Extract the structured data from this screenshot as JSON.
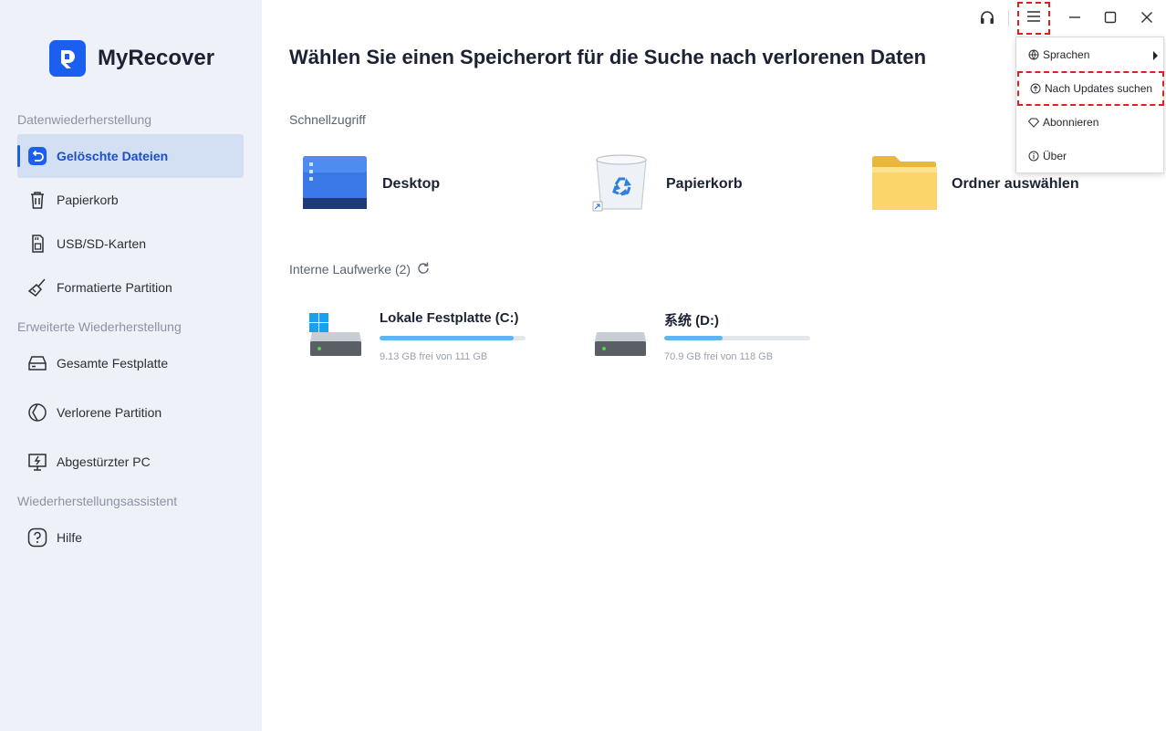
{
  "app": {
    "name": "MyRecover"
  },
  "sidebar": {
    "sections": [
      {
        "title": "Datenwiederherstellung"
      },
      {
        "title": "Erweiterte Wiederherstellung"
      },
      {
        "title": "Wiederherstellungsassistent"
      }
    ],
    "items": [
      {
        "label": "Gelöschte Dateien",
        "icon": "restore-icon",
        "active": true
      },
      {
        "label": "Papierkorb",
        "icon": "trash-icon"
      },
      {
        "label": "USB/SD-Karten",
        "icon": "sd-card-icon"
      },
      {
        "label": "Formatierte Partition",
        "icon": "broom-icon"
      },
      {
        "label": "Gesamte Festplatte",
        "icon": "hard-drive-icon"
      },
      {
        "label": "Verlorene Partition",
        "icon": "partition-icon"
      },
      {
        "label": "Abgestürzter PC",
        "icon": "crashed-pc-icon"
      },
      {
        "label": "Hilfe",
        "icon": "help-icon"
      }
    ]
  },
  "main": {
    "title": "Wählen Sie einen Speicherort für die Suche nach verlorenen Daten",
    "quick_access": {
      "title": "Schnellzugriff",
      "items": [
        {
          "label": "Desktop",
          "icon": "desktop-icon"
        },
        {
          "label": "Papierkorb",
          "icon": "recycle-bin-icon"
        },
        {
          "label": "Ordner auswählen",
          "icon": "folder-icon"
        }
      ]
    },
    "drives": {
      "title": "Interne Laufwerke (2)",
      "items": [
        {
          "name": "Lokale Festplatte (C:)",
          "size_text": "9.13 GB frei von 111 GB",
          "used_fraction": 0.92,
          "icon": "windows-drive-icon"
        },
        {
          "name": "系统 (D:)",
          "size_text": "70.9 GB frei von 118 GB",
          "used_fraction": 0.4,
          "icon": "drive-icon"
        }
      ]
    }
  },
  "menu": {
    "items": [
      {
        "label": "Sprachen",
        "icon": "globe-icon",
        "submenu": true
      },
      {
        "label": "Nach Updates suchen",
        "icon": "update-icon",
        "highlighted": true
      },
      {
        "label": "Abonnieren",
        "icon": "diamond-icon"
      },
      {
        "label": "Über",
        "icon": "info-icon"
      }
    ]
  },
  "colors": {
    "accent": "#1a5ff0",
    "sidebar_bg": "#eef1f7",
    "active_bg": "#d3dff3",
    "progress": "#5fb5ee",
    "highlight": "#e0201c"
  }
}
